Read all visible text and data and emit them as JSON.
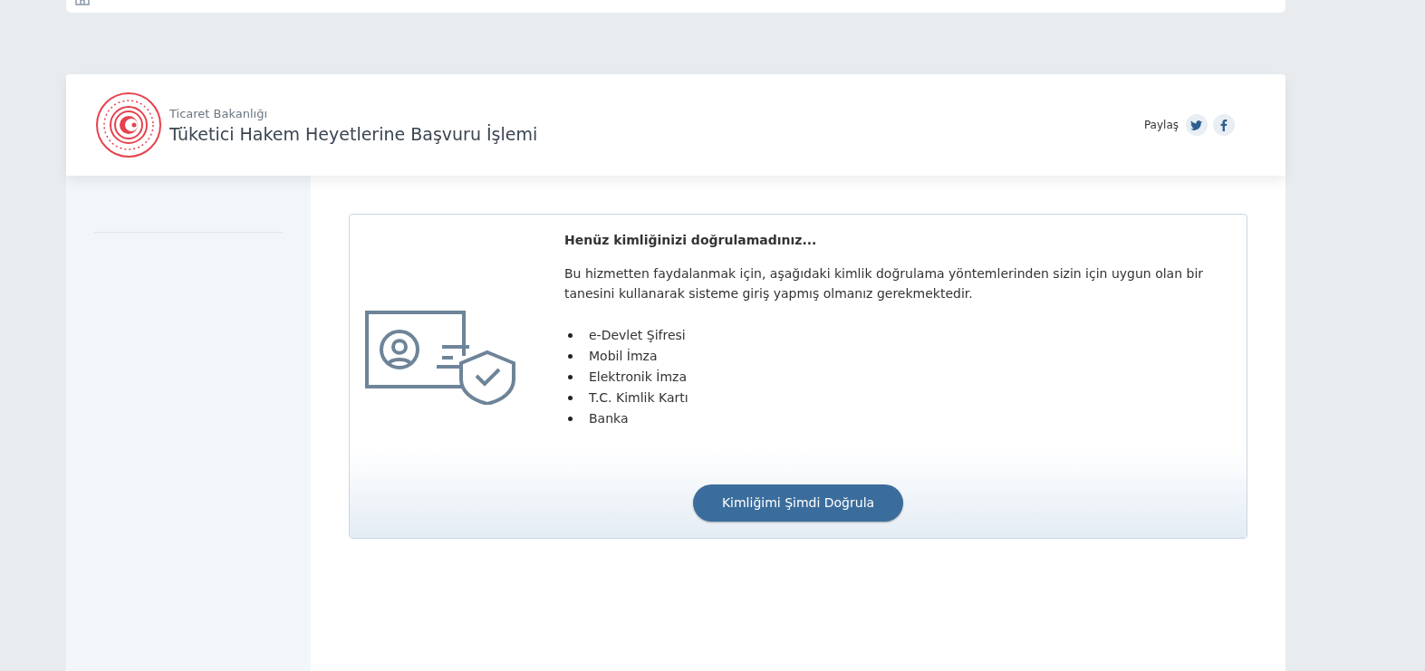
{
  "header": {
    "ministry": "Ticaret Bakanlığı",
    "title": "Tüketici Hakem Heyetlerine Başvuru İşlemi",
    "share_label": "Paylaş"
  },
  "notice": {
    "heading": "Henüz kimliğinizi doğrulamadınız...",
    "text": "Bu hizmetten faydalanmak için, aşağıdaki kimlik doğrulama yöntemlerinden sizin için uygun olan bir tanesini kullanarak sisteme giriş yapmış olmanız gerekmektedir.",
    "methods": [
      "e-Devlet Şifresi",
      "Mobil İmza",
      "Elektronik İmza",
      "T.C. Kimlik Kartı",
      "Banka"
    ],
    "button": "Kimliğimi Şimdi Doğrula"
  }
}
